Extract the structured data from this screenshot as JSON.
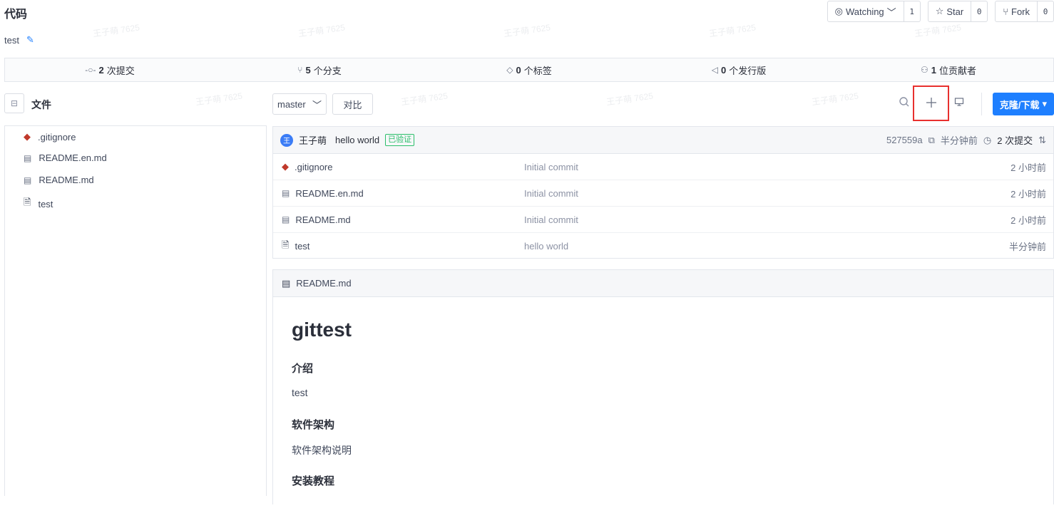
{
  "header": {
    "title": "代码",
    "repo_desc": "test",
    "edit_icon": "edit-icon"
  },
  "actions": {
    "watch_label": "Watching",
    "watch_count": "1",
    "star_label": "Star",
    "star_count": "0",
    "fork_label": "Fork",
    "fork_count": "0"
  },
  "stats": {
    "commits": {
      "num": "2",
      "unit": "次提交"
    },
    "branches": {
      "num": "5",
      "unit": "个分支"
    },
    "tags": {
      "num": "0",
      "unit": "个标签"
    },
    "releases": {
      "num": "0",
      "unit": "个发行版"
    },
    "contributors": {
      "num": "1",
      "unit": "位贡献者"
    }
  },
  "toolbar": {
    "files_label": "文件",
    "branch": "master",
    "compare": "对比",
    "clone": "克隆/下载"
  },
  "tree": [
    {
      "name": ".gitignore",
      "icon": "git-icon"
    },
    {
      "name": "README.en.md",
      "icon": "book-icon"
    },
    {
      "name": "README.md",
      "icon": "book-icon"
    },
    {
      "name": "test",
      "icon": "file-icon"
    }
  ],
  "commit": {
    "avatar": "王",
    "author": "王子萌",
    "message": "hello world",
    "verified": "已验证",
    "hash": "527559a",
    "time": "半分钟前",
    "history": "2 次提交"
  },
  "files": [
    {
      "name": ".gitignore",
      "msg": "Initial commit",
      "time": "2 小时前",
      "icon": "git-icon"
    },
    {
      "name": "README.en.md",
      "msg": "Initial commit",
      "time": "2 小时前",
      "icon": "book-icon"
    },
    {
      "name": "README.md",
      "msg": "Initial commit",
      "time": "2 小时前",
      "icon": "book-icon"
    },
    {
      "name": "test",
      "msg": "hello world",
      "time": "半分钟前",
      "icon": "file-icon"
    }
  ],
  "readme": {
    "filename": "README.md",
    "h1": "gittest",
    "s1_title": "介绍",
    "s1_text": "test",
    "s2_title": "软件架构",
    "s2_text": "软件架构说明",
    "s3_title": "安装教程"
  },
  "watermark": "王子萌 7625",
  "colors": {
    "accent": "#1e7fff",
    "highlight": "#e8302e",
    "verified": "#2bbf6a"
  }
}
